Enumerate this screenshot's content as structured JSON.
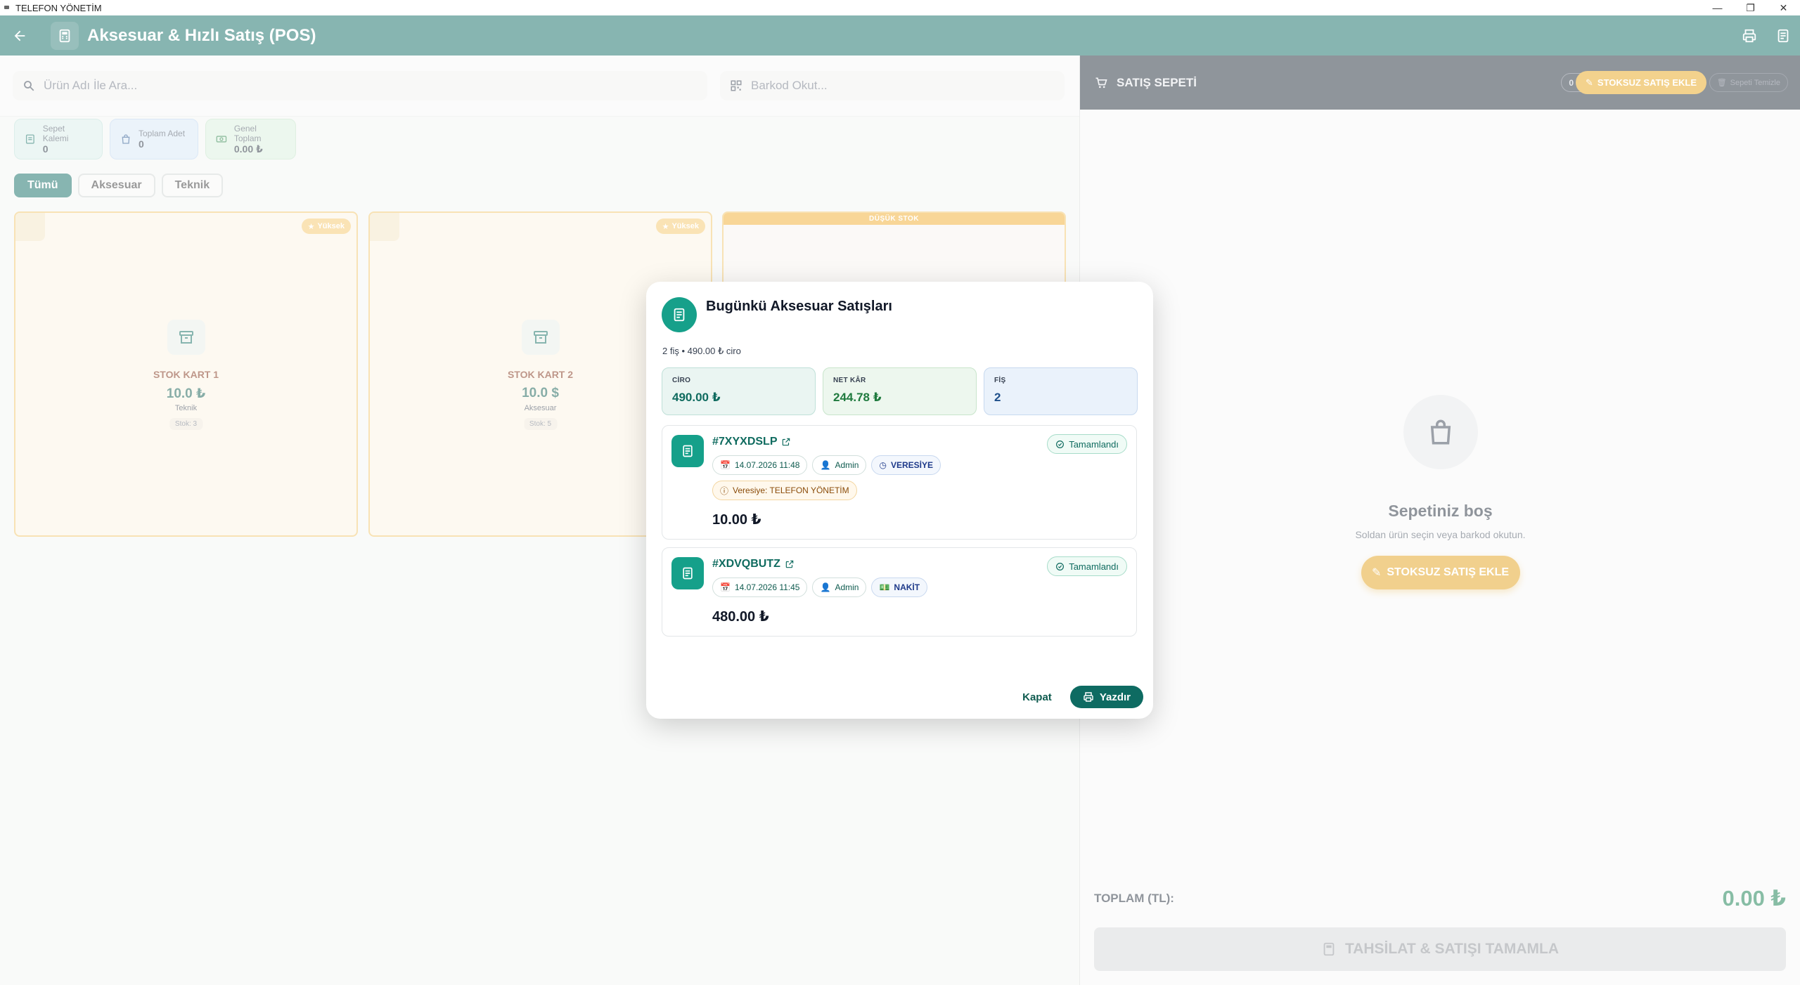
{
  "window": {
    "title": "TELEFON YÖNETİM"
  },
  "header": {
    "title": "Aksesuar & Hızlı Satış (POS)"
  },
  "search": {
    "product_placeholder": "Ürün Adı İle Ara...",
    "barcode_placeholder": "Barkod Okut..."
  },
  "stats": [
    {
      "label": "Sepet Kalemi",
      "value": "0"
    },
    {
      "label": "Toplam Adet",
      "value": "0"
    },
    {
      "label": "Genel Toplam",
      "value": "0.00 ₺"
    }
  ],
  "filters": {
    "all": "Tümü",
    "accessory": "Aksesuar",
    "technical": "Teknik"
  },
  "products": [
    {
      "name": "STOK KART 1",
      "price": "10.0 ₺",
      "category": "Teknik",
      "stock": "Stok: 3",
      "badge": "Yüksek"
    },
    {
      "name": "STOK KART 2",
      "price": "10.0 $",
      "category": "Aksesuar",
      "stock": "Stok: 5",
      "badge": "Yüksek"
    }
  ],
  "low_stock_label": "DÜŞÜK STOK",
  "cart": {
    "title": "SATIŞ SEPETİ",
    "count": "0 ürün",
    "add_unstocked": "STOKSUZ SATIŞ EKLE",
    "clear": "Sepeti Temizle",
    "empty_title": "Sepetiniz boş",
    "empty_sub": "Soldan ürün seçin veya barkod okutun.",
    "total_label": "TOPLAM (TL):",
    "total_value": "0.00 ₺",
    "complete": "TAHSİLAT & SATIŞI TAMAMLA"
  },
  "dialog": {
    "title": "Bugünkü Aksesuar Satışları",
    "subtitle": "2 fiş • 490.00 ₺ ciro",
    "kpis": [
      {
        "label": "CİRO",
        "value": "490.00 ₺"
      },
      {
        "label": "NET KÂR",
        "value": "244.78 ₺"
      },
      {
        "label": "FİŞ",
        "value": "2"
      }
    ],
    "receipts": [
      {
        "no": "#7XYXDSLP",
        "status": "Tamamlandı",
        "datetime": "14.07.2026 11:48",
        "user": "Admin",
        "payment": "VERESİYE",
        "credit_note": "Veresiye: TELEFON YÖNETİM",
        "amount": "10.00 ₺"
      },
      {
        "no": "#XDVQBUTZ",
        "status": "Tamamlandı",
        "datetime": "14.07.2026 11:45",
        "user": "Admin",
        "payment": "NAKİT",
        "amount": "480.00 ₺"
      }
    ],
    "close": "Kapat",
    "print": "Yazdır"
  },
  "colors": {
    "primary": "#0e6b62",
    "accent": "#e7a51a",
    "dark": "#1f2a37",
    "success": "#0f7a4a"
  }
}
